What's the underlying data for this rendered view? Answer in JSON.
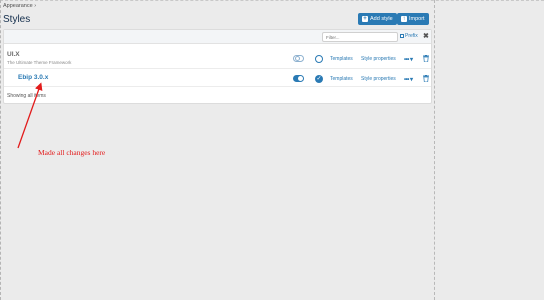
{
  "breadcrumb": "Appearance ›",
  "page_title": "Styles",
  "buttons": {
    "add_style": "Add style",
    "import": "Import"
  },
  "filter": {
    "placeholder": "Filter...",
    "prefix_label": "Prefix",
    "clear_symbol": "✖"
  },
  "styles": [
    {
      "title": "UI.X",
      "subtitle": "The Ultimate Theme Framework",
      "enabled": false,
      "default": false,
      "templates_label": "Templates",
      "properties_label": "Style properties",
      "menu": "••• ▾"
    },
    {
      "title": "Ebip 3.0.x",
      "subtitle": "",
      "enabled": true,
      "default": true,
      "templates_label": "Templates",
      "properties_label": "Style properties",
      "menu": "••• ▾"
    }
  ],
  "footer": {
    "showing": "Showing all items"
  },
  "annotation": {
    "text": "Made all changes here",
    "color": "#e21b1b"
  },
  "colors": {
    "accent": "#2a7ab4",
    "title": "#152f4d",
    "background": "#ebebeb"
  }
}
